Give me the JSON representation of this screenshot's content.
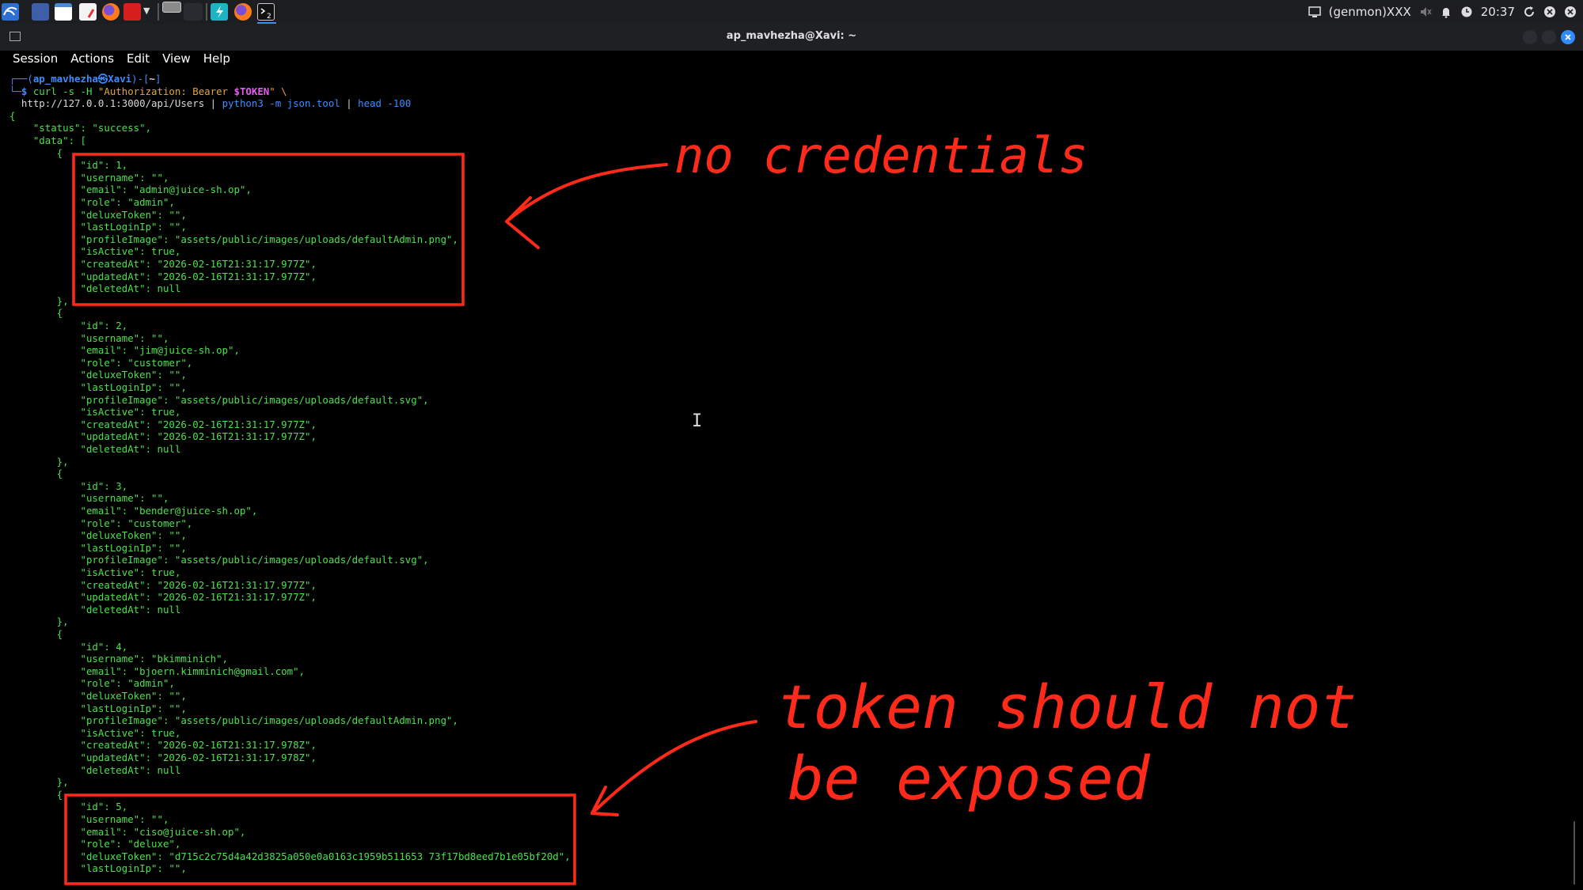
{
  "taskbar": {
    "icons": [
      "kali-menu-icon",
      "desktop-icon",
      "file-manager-icon",
      "text-editor-icon",
      "firefox-icon",
      "terminal-red-icon",
      "dropdown-arrow-icon",
      "workspace-1-icon",
      "workspace-2-icon",
      "burp-icon",
      "firefox-icon",
      "terminal-icon"
    ],
    "tray": {
      "monitor": "(genmon)XXX",
      "time": "20:37"
    }
  },
  "window": {
    "title": "ap_mavhezha@Xavi: ~"
  },
  "menu": [
    "Session",
    "Actions",
    "Edit",
    "View",
    "Help"
  ],
  "prompt": {
    "user": "ap_mavhezha㉿Xavi",
    "dir": "~"
  },
  "command": {
    "part1": "curl -s -H ",
    "header": "\"Authorization: Bearer ",
    "token_var": "$TOKEN",
    "header_end": "\" \\",
    "url": "http://127.0.0.1:3000/api/Users",
    "pipe1": " | ",
    "python": "python3 -m json.tool",
    "pipe2": " | ",
    "head": "head -100"
  },
  "output": [
    "{",
    "    \"status\": \"success\",",
    "    \"data\": [",
    "        {",
    "            \"id\": 1,",
    "            \"username\": \"\",",
    "            \"email\": \"admin@juice-sh.op\",",
    "            \"role\": \"admin\",",
    "            \"deluxeToken\": \"\",",
    "            \"lastLoginIp\": \"\",",
    "            \"profileImage\": \"assets/public/images/uploads/defaultAdmin.png\",",
    "            \"isActive\": true,",
    "            \"createdAt\": \"2026-02-16T21:31:17.977Z\",",
    "            \"updatedAt\": \"2026-02-16T21:31:17.977Z\",",
    "            \"deletedAt\": null",
    "        },",
    "        {",
    "            \"id\": 2,",
    "            \"username\": \"\",",
    "            \"email\": \"jim@juice-sh.op\",",
    "            \"role\": \"customer\",",
    "            \"deluxeToken\": \"\",",
    "            \"lastLoginIp\": \"\",",
    "            \"profileImage\": \"assets/public/images/uploads/default.svg\",",
    "            \"isActive\": true,",
    "            \"createdAt\": \"2026-02-16T21:31:17.977Z\",",
    "            \"updatedAt\": \"2026-02-16T21:31:17.977Z\",",
    "            \"deletedAt\": null",
    "        },",
    "        {",
    "            \"id\": 3,",
    "            \"username\": \"\",",
    "            \"email\": \"bender@juice-sh.op\",",
    "            \"role\": \"customer\",",
    "            \"deluxeToken\": \"\",",
    "            \"lastLoginIp\": \"\",",
    "            \"profileImage\": \"assets/public/images/uploads/default.svg\",",
    "            \"isActive\": true,",
    "            \"createdAt\": \"2026-02-16T21:31:17.977Z\",",
    "            \"updatedAt\": \"2026-02-16T21:31:17.977Z\",",
    "            \"deletedAt\": null",
    "        },",
    "        {",
    "            \"id\": 4,",
    "            \"username\": \"bkimminich\",",
    "            \"email\": \"bjoern.kimminich@gmail.com\",",
    "            \"role\": \"admin\",",
    "            \"deluxeToken\": \"\",",
    "            \"lastLoginIp\": \"\",",
    "            \"profileImage\": \"assets/public/images/uploads/defaultAdmin.png\",",
    "            \"isActive\": true,",
    "            \"createdAt\": \"2026-02-16T21:31:17.978Z\",",
    "            \"updatedAt\": \"2026-02-16T21:31:17.978Z\",",
    "            \"deletedAt\": null",
    "        },",
    "        {",
    "            \"id\": 5,",
    "            \"username\": \"\",",
    "            \"email\": \"ciso@juice-sh.op\",",
    "            \"role\": \"deluxe\",",
    "            \"deluxeToken\": \"d715c2c75d4a42d3825a050e0a0163c1959b511653 73f17bd8eed7b1e05bf20d\",",
    "            \"lastLoginIp\": \"\","
  ],
  "annotations": {
    "note1": "no credentials",
    "note2_line1": "token should not",
    "note2_line2": "be exposed",
    "color": "#ff2a1a"
  }
}
